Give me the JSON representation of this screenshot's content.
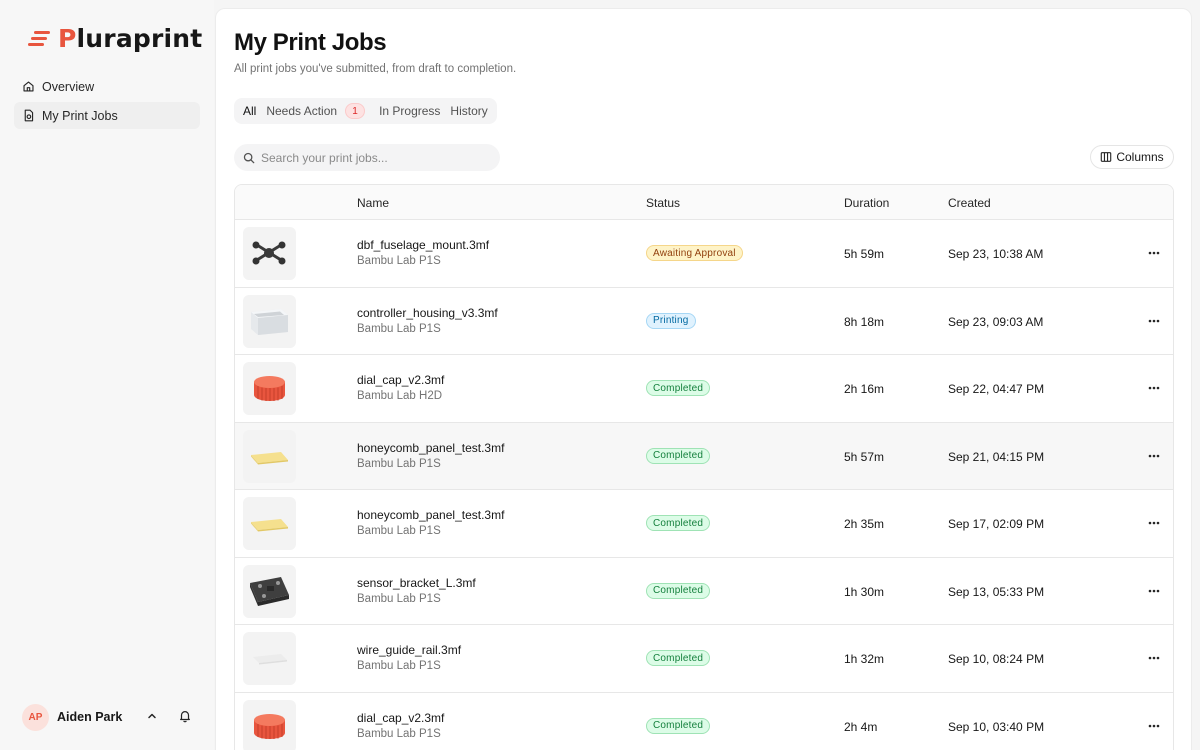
{
  "brand": {
    "name_first": "P",
    "name_rest": "luraprint",
    "accent": "#e8553e"
  },
  "nav": {
    "items": [
      {
        "label": "Overview",
        "icon": "home-icon"
      },
      {
        "label": "My Print Jobs",
        "icon": "print-jobs-icon"
      }
    ]
  },
  "user": {
    "initials": "AP",
    "name": "Aiden Park"
  },
  "page": {
    "title": "My Print Jobs",
    "subtitle": "All print jobs you've submitted, from draft to completion."
  },
  "tabs": {
    "all": "All",
    "needs_action": "Needs Action",
    "needs_action_count": "1",
    "in_progress": "In Progress",
    "history": "History"
  },
  "search": {
    "placeholder": "Search your print jobs..."
  },
  "toolbar": {
    "columns_label": "Columns"
  },
  "table": {
    "headers": {
      "name": "Name",
      "status": "Status",
      "duration": "Duration",
      "created": "Created"
    },
    "rows": [
      {
        "name": "dbf_fuselage_mount.3mf",
        "printer": "Bambu Lab P1S",
        "status": "Awaiting Approval",
        "duration": "5h 59m",
        "created": "Sep 23, 10:38 AM"
      },
      {
        "name": "controller_housing_v3.3mf",
        "printer": "Bambu Lab P1S",
        "status": "Printing",
        "duration": "8h 18m",
        "created": "Sep 23, 09:03 AM"
      },
      {
        "name": "dial_cap_v2.3mf",
        "printer": "Bambu Lab H2D",
        "status": "Completed",
        "duration": "2h 16m",
        "created": "Sep 22, 04:47 PM"
      },
      {
        "name": "honeycomb_panel_test.3mf",
        "printer": "Bambu Lab P1S",
        "status": "Completed",
        "duration": "5h 57m",
        "created": "Sep 21, 04:15 PM"
      },
      {
        "name": "honeycomb_panel_test.3mf",
        "printer": "Bambu Lab P1S",
        "status": "Completed",
        "duration": "2h 35m",
        "created": "Sep 17, 02:09 PM"
      },
      {
        "name": "sensor_bracket_L.3mf",
        "printer": "Bambu Lab P1S",
        "status": "Completed",
        "duration": "1h 30m",
        "created": "Sep 13, 05:33 PM"
      },
      {
        "name": "wire_guide_rail.3mf",
        "printer": "Bambu Lab P1S",
        "status": "Completed",
        "duration": "1h 32m",
        "created": "Sep 10, 08:24 PM"
      },
      {
        "name": "dial_cap_v2.3mf",
        "printer": "Bambu Lab P1S",
        "status": "Completed",
        "duration": "2h 4m",
        "created": "Sep 10, 03:40 PM"
      }
    ]
  },
  "colors": {
    "awaiting": "#92400e",
    "printing": "#0369a1",
    "completed": "#15803d",
    "badge": "#dc2626"
  }
}
